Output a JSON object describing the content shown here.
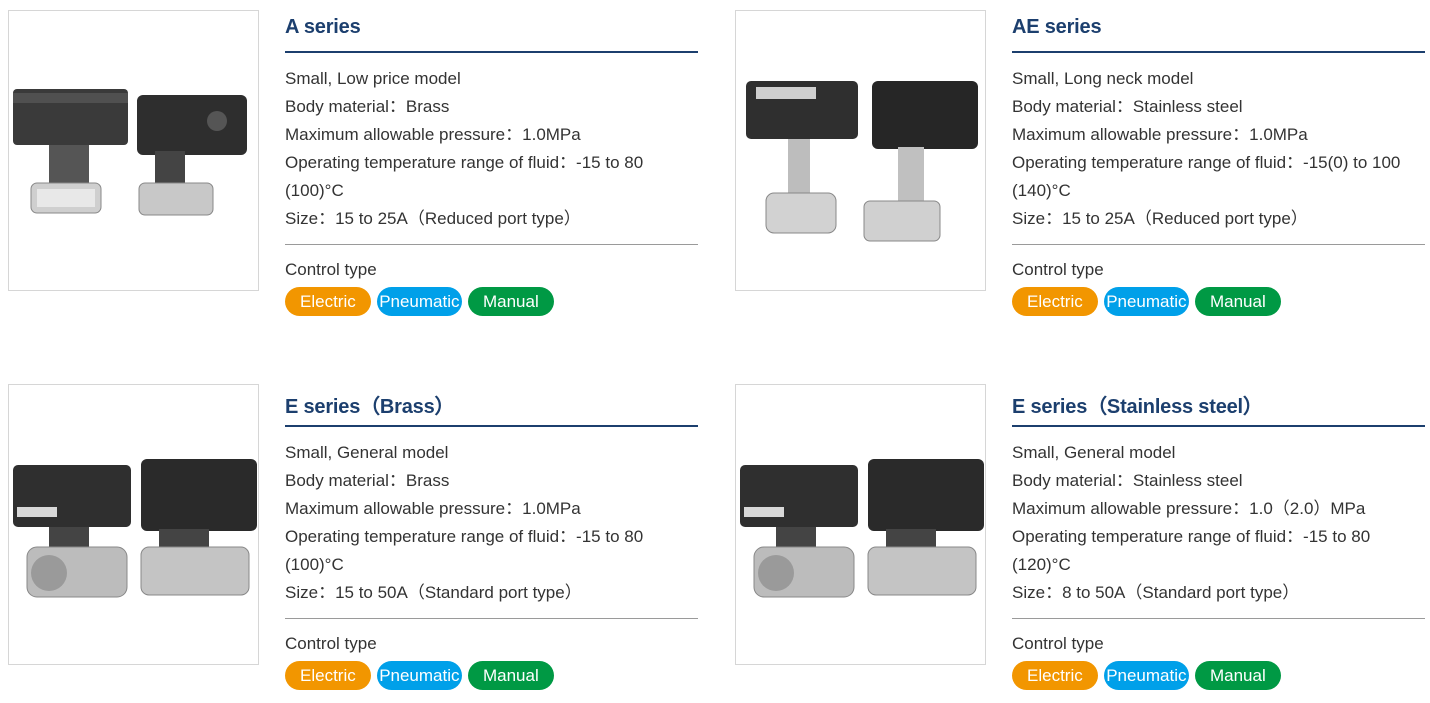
{
  "colors": {
    "title": "#1c3f6e",
    "electric": "#f29600",
    "pneumatic": "#00a0e9",
    "manual": "#009944"
  },
  "control_label": "Control type",
  "badges": {
    "electric": "Electric",
    "pneumatic": "Pneumatic",
    "manual": "Manual"
  },
  "products": [
    {
      "title": "A series",
      "specs": [
        "Small, Low price model",
        "Body material：Brass",
        "Maximum allowable pressure：1.0MPa",
        "Operating temperature range of fluid：-15 to 80",
        "(100)°C",
        "Size：15 to 25A（Reduced port type）"
      ]
    },
    {
      "title": "AE series",
      "specs": [
        "Small, Long neck model",
        "Body material：Stainless steel",
        "Maximum allowable pressure：1.0MPa",
        "Operating temperature range of fluid：-15(0) to 100",
        "(140)°C",
        "Size：15 to 25A（Reduced port type）"
      ]
    },
    {
      "title": "E series（Brass）",
      "specs": [
        "Small, General model",
        "Body material：Brass",
        "Maximum allowable pressure：1.0MPa",
        "Operating temperature range of fluid：-15 to 80",
        "(100)°C",
        "Size：15 to 50A（Standard port type）"
      ]
    },
    {
      "title": "E series（Stainless steel）",
      "specs": [
        "Small, General model",
        "Body material：Stainless steel",
        "Maximum allowable pressure：1.0（2.0）MPa",
        "Operating temperature range of fluid：-15 to 80",
        "(120)°C",
        "Size：8 to 50A（Standard port type）"
      ]
    }
  ]
}
